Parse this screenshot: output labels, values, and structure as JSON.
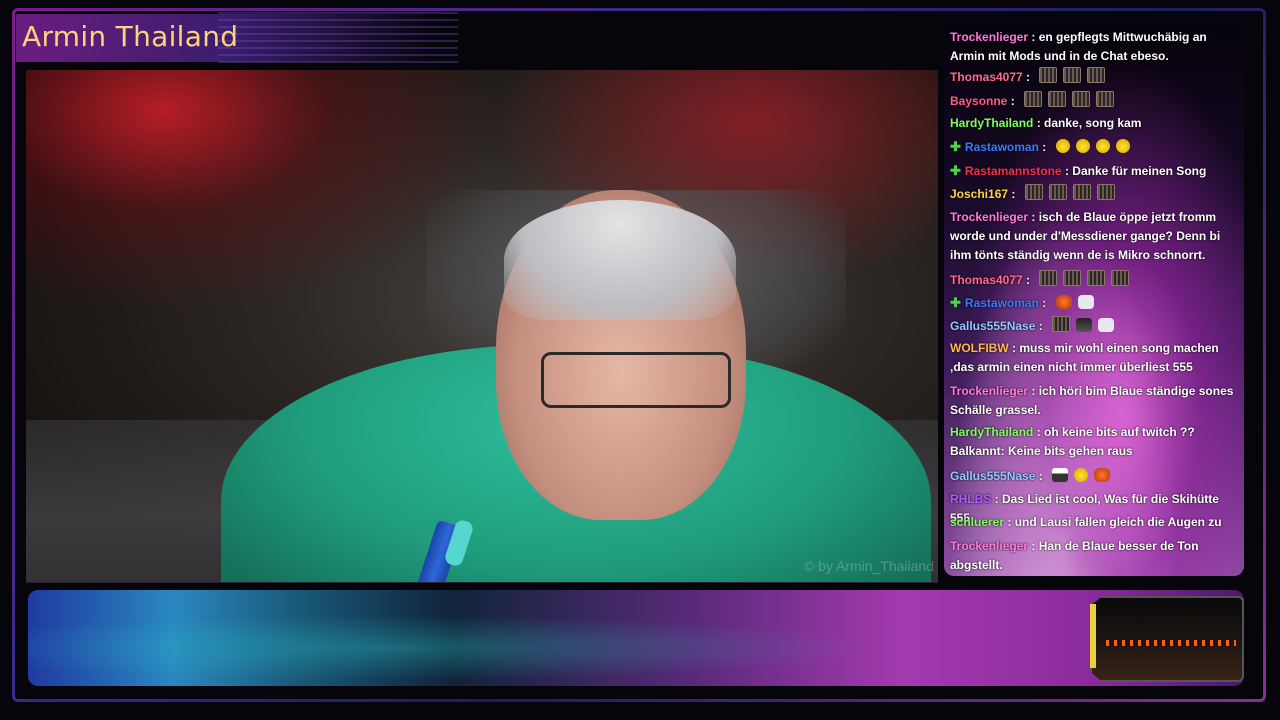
{
  "channel": {
    "title": "Armin Thailand"
  },
  "video": {
    "watermark": "© by Armin_Thailand"
  },
  "chat": {
    "messages": [
      {
        "user": "Trockenlieger",
        "color": "#ff7ad9",
        "text": "en gepflegts Mittwuchäbig an Armin mit Mods und in de Chat ebeso.",
        "emotes": []
      },
      {
        "user": "Thomas4077",
        "color": "#ff6a8a",
        "text": "",
        "emotes": [
          "gate",
          "gate",
          "gate"
        ]
      },
      {
        "user": "Baysonne",
        "color": "#ff5a8a",
        "text": "",
        "emotes": [
          "gate",
          "gate",
          "gate",
          "gate"
        ]
      },
      {
        "user": "HardyThailand",
        "color": "#7dff5a",
        "text": "danke, song kam",
        "emotes": []
      },
      {
        "user": "Rastawoman",
        "color": "#3a7aff",
        "badge": true,
        "text": "",
        "emotes": [
          "yellow",
          "yellow",
          "yellow",
          "yellow"
        ]
      },
      {
        "user": "Rastamannstone",
        "color": "#ff2a4a",
        "badge": true,
        "text": "Danke für meinen Song",
        "emotes": []
      },
      {
        "user": "Joschi167",
        "color": "#ffd24a",
        "text": "",
        "emotes": [
          "gate",
          "gate",
          "gate",
          "gate"
        ]
      },
      {
        "user": "Trockenlieger",
        "color": "#ff7ad9",
        "text": "isch de Blaue öppe jetzt fromm worde und under d'Messdiener gange? Denn bi ihm tönts ständig wenn de is Mikro schnorrt.",
        "emotes": []
      },
      {
        "user": "Thomas4077",
        "color": "#ff6a8a",
        "text": "",
        "emotes": [
          "gate",
          "gate",
          "gate",
          "gate"
        ]
      },
      {
        "user": "Rastawoman",
        "color": "#3a7aff",
        "badge": true,
        "text": "",
        "emotes": [
          "fox",
          "white"
        ]
      },
      {
        "user": "Gallus555Nase",
        "color": "#8fc7ff",
        "text": "",
        "emotes": [
          "gate",
          "glasses-emo",
          "white"
        ]
      },
      {
        "user": "WOLFIBW",
        "color": "#ffb84a",
        "text": "muss mir wohl einen song machen ,das armin einen nicht immer überliest 555",
        "emotes": []
      },
      {
        "user": "Trockenlieger",
        "color": "#ff7ad9",
        "text": "ich höri bim Blaue ständige sones Schälle grassel.",
        "emotes": []
      },
      {
        "user": "HardyThailand",
        "color": "#7dff5a",
        "text": "oh keine bits auf twitch ?? Balkannt: Keine bits gehen raus",
        "emotes": []
      },
      {
        "user": "Gallus555Nase",
        "color": "#8fc7ff",
        "text": "",
        "emotes": [
          "penguin",
          "yellow",
          "fox"
        ]
      },
      {
        "user": "RHLBS",
        "color": "#b05aff",
        "text": "Das Lied ist cool, Was für die Skihütte 555",
        "emotes": []
      },
      {
        "user": "schluerer",
        "color": "#7dff5a",
        "text": "und Lausi fallen gleich die Augen zu",
        "emotes": []
      },
      {
        "user": "Trockenlieger",
        "color": "#ff7ad9",
        "text": "Han de Blaue besser de Ton abgstellt.",
        "emotes": []
      }
    ]
  }
}
